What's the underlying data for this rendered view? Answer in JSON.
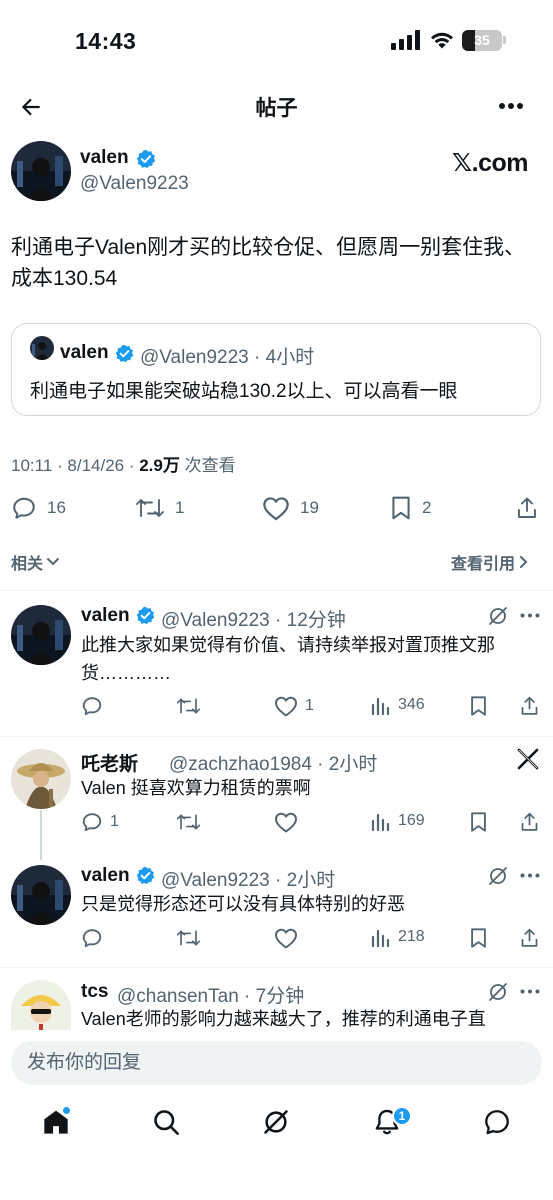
{
  "status_bar": {
    "time": "14:43",
    "battery": "35"
  },
  "header": {
    "title": "帖子"
  },
  "post": {
    "author_name": "valen",
    "author_handle": "@Valen9223",
    "source_label": "𝕏.com",
    "text": "利通电子Valen刚才买的比较仓促、但愿周一别套住我、成本130.54",
    "quote": {
      "author_name": "valen",
      "meta": "@Valen9223 · 4小时",
      "text": "利通电子如果能突破站稳130.2以上、可以高看一眼"
    },
    "timestamp": "10:11 · 8/14/26 · ",
    "views_value": "2.9万",
    "views_label": " 次查看",
    "actions": {
      "replies": "16",
      "reposts": "1",
      "likes": "19",
      "bookmarks": "2"
    }
  },
  "sections": {
    "related": "相关",
    "view_quotes": "查看引用"
  },
  "replies": [
    {
      "author_name": "valen",
      "meta": "@Valen9223 · 12分钟",
      "text": "此推大家如果觉得有价值、请持续举报对置顶推文那货…………",
      "replies": "",
      "likes": "1",
      "views": "346"
    },
    {
      "author_name": "吒老斯",
      "meta": "@zachzhao1984 · 2小时",
      "text": "Valen 挺喜欢算力租赁的票啊",
      "replies": "1",
      "likes": "",
      "views": "169"
    },
    {
      "author_name": "valen",
      "meta": "@Valen9223 · 2小时",
      "text": "只是觉得形态还可以没有具体特别的好恶",
      "replies": "",
      "likes": "",
      "views": "218"
    },
    {
      "author_name": "tcs",
      "meta": "@chansenTan · 7分钟",
      "text": "Valen老师的影响力越来越大了，推荐的利通电子直"
    }
  ],
  "composer": {
    "placeholder": "发布你的回复"
  },
  "tab_bar": {
    "notifications_count": "1"
  },
  "colors": {
    "accent": "#1d9bf0",
    "text": "#0f1419",
    "secondary": "#536471"
  }
}
